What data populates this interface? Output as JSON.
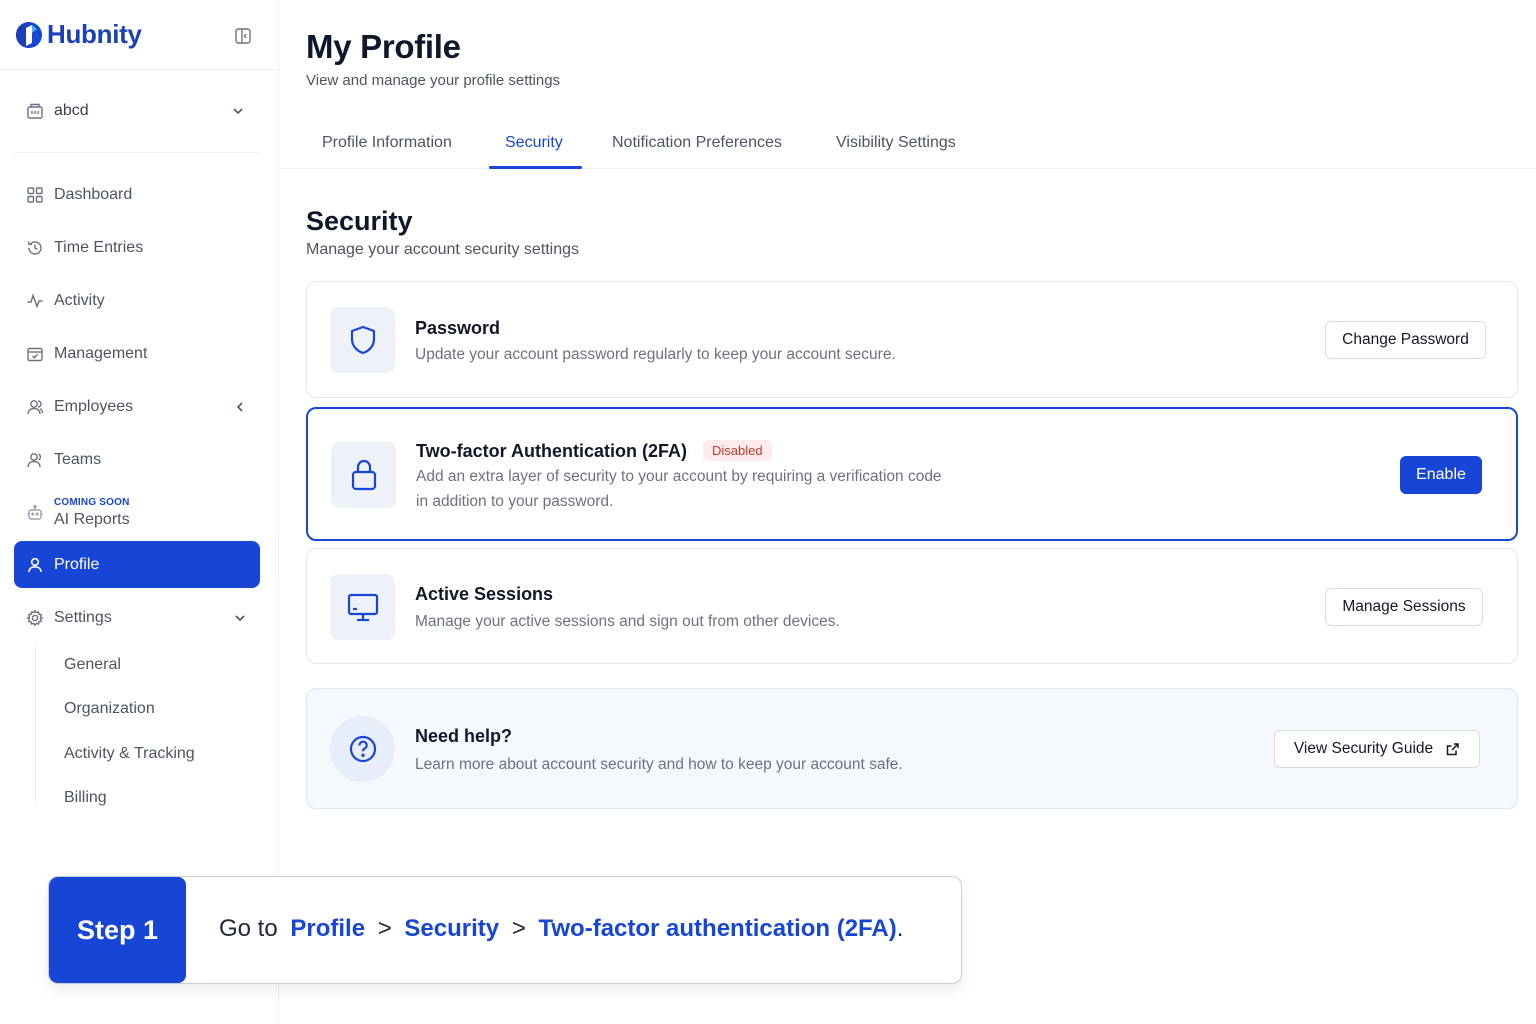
{
  "brand": {
    "name": "Hubnity"
  },
  "org": {
    "name": "abcd"
  },
  "nav": {
    "dashboard": "Dashboard",
    "time_entries": "Time Entries",
    "activity": "Activity",
    "management": "Management",
    "employees": "Employees",
    "teams": "Teams",
    "ai_reports_tag": "COMING SOON",
    "ai_reports": "AI Reports",
    "profile": "Profile",
    "settings": "Settings",
    "settings_sub": [
      "General",
      "Organization",
      "Activity & Tracking",
      "Billing"
    ]
  },
  "page": {
    "title": "My Profile",
    "subtitle": "View and manage your profile settings"
  },
  "tabs": [
    "Profile Information",
    "Security",
    "Notification Preferences",
    "Visibility Settings"
  ],
  "active_tab": "Security",
  "section": {
    "title": "Security",
    "subtitle": "Manage your account security settings"
  },
  "cards": {
    "password": {
      "title": "Password",
      "desc": "Update your account password regularly to keep your account secure.",
      "button": "Change Password"
    },
    "twofa": {
      "title": "Two-factor Authentication (2FA)",
      "badge": "Disabled",
      "desc_line1": "Add an extra layer of security to your account by requiring a verification code",
      "desc_line2": "in addition to your password.",
      "button": "Enable"
    },
    "sessions": {
      "title": "Active Sessions",
      "desc": "Manage your active sessions and sign out from other devices.",
      "button": "Manage Sessions"
    },
    "help": {
      "title": "Need help?",
      "desc": "Learn more about account security and how to keep your account safe.",
      "button": "View Security Guide"
    }
  },
  "step": {
    "tag": "Step 1",
    "prefix": "Go to",
    "path": [
      "Profile",
      "Security",
      "Two-factor authentication (2FA)"
    ],
    "separator": ">",
    "suffix": "."
  },
  "colors": {
    "accent": "#1746d6",
    "brand_text": "#1a3fb8",
    "badge_bg": "#fdeceb",
    "badge_text": "#c0392b"
  },
  "icons": {
    "brand": "hubnity-logo-icon",
    "collapse": "sidebar-collapse-icon",
    "org": "building-icon",
    "dashboard": "grid-icon",
    "time_entries": "history-icon",
    "activity": "pulse-icon",
    "management": "calendar-check-icon",
    "employees": "users-icon",
    "teams": "team-icon",
    "ai_reports": "robot-icon",
    "profile": "user-icon",
    "settings": "gear-icon",
    "password": "shield-icon",
    "twofa": "lock-icon",
    "sessions": "monitor-icon",
    "help": "question-icon",
    "external": "external-link-icon"
  }
}
